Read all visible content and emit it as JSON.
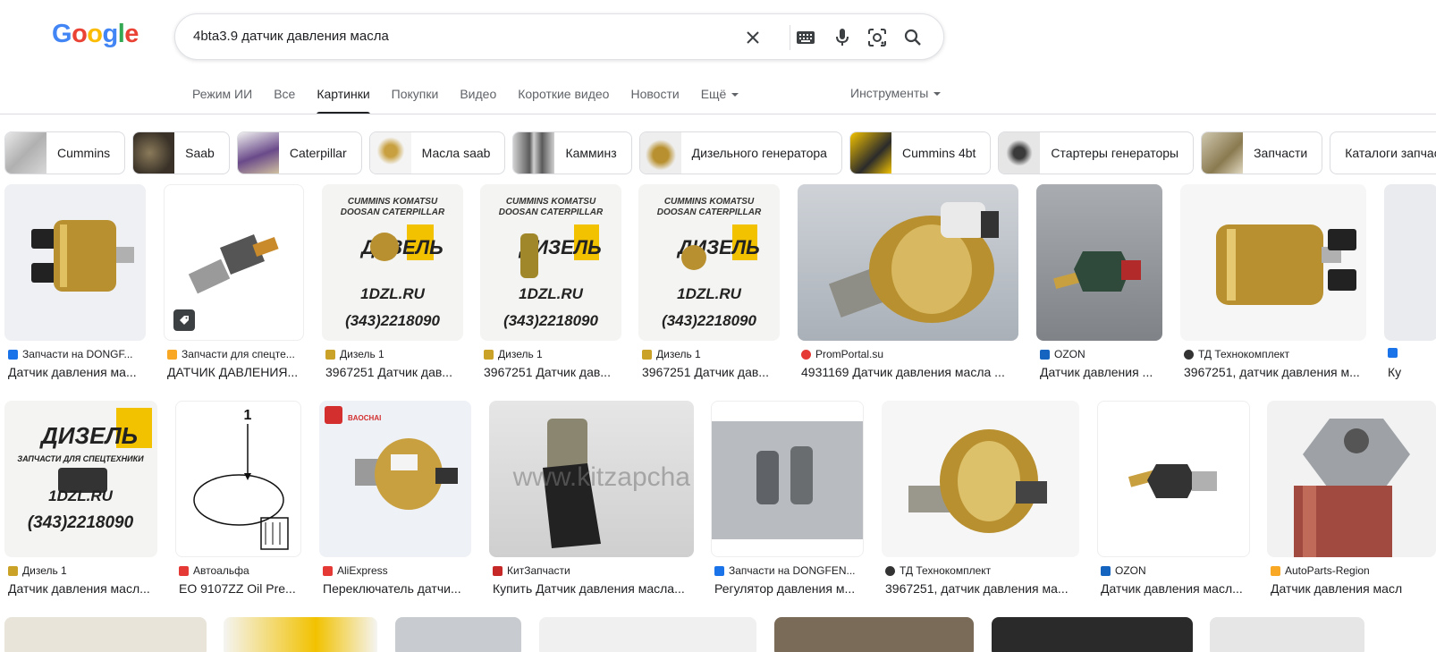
{
  "header": {
    "logo_text": "Google",
    "search_query": "4bta3.9 датчик давления масла"
  },
  "tabs": [
    {
      "label": "Режим ИИ"
    },
    {
      "label": "Все"
    },
    {
      "label": "Картинки",
      "active": true
    },
    {
      "label": "Покупки"
    },
    {
      "label": "Видео"
    },
    {
      "label": "Короткие видео"
    },
    {
      "label": "Новости"
    },
    {
      "label": "Ещё"
    }
  ],
  "tools_label": "Инструменты",
  "chips": [
    {
      "label": "Cummins"
    },
    {
      "label": "Saab"
    },
    {
      "label": "Caterpillar"
    },
    {
      "label": "Масла saab"
    },
    {
      "label": "Камминз"
    },
    {
      "label": "Дизельного генератора"
    },
    {
      "label": "Cummins 4bt"
    },
    {
      "label": "Стартеры генераторы"
    },
    {
      "label": "Запчасти"
    },
    {
      "label": "Каталоги запчастей"
    }
  ],
  "row1": [
    {
      "source": "Запчасти на DONGF...",
      "title": "Датчик давления ма...",
      "fav_color": "#1a73e8"
    },
    {
      "source": "Запчасти для спецте...",
      "title": "ДАТЧИК ДАВЛЕНИЯ...",
      "fav_color": "#f9a825"
    },
    {
      "source": "Дизель 1",
      "title": "3967251 Датчик дав...",
      "fav_color": "#c9a227"
    },
    {
      "source": "Дизель 1",
      "title": "3967251 Датчик дав...",
      "fav_color": "#c9a227"
    },
    {
      "source": "Дизель 1",
      "title": "3967251 Датчик дав...",
      "fav_color": "#c9a227"
    },
    {
      "source": "PromPortal.su",
      "title": "4931169 Датчик давления масла ...",
      "fav_color": "#e53935"
    },
    {
      "source": "OZON",
      "title": "Датчик давления ...",
      "fav_color": "#1565c0"
    },
    {
      "source": "ТД Технокомплект",
      "title": "3967251, датчик давления м...",
      "fav_color": "#333333"
    },
    {
      "source": "",
      "title": "Ку",
      "fav_color": "#1a73e8"
    }
  ],
  "row2": [
    {
      "source": "Дизель 1",
      "title": "Датчик давления масл...",
      "fav_color": "#c9a227"
    },
    {
      "source": "Автоальфа",
      "title": "EO 9107ZZ Oil Pre...",
      "fav_color": "#e53935"
    },
    {
      "source": "AliExpress",
      "title": "Переключатель датчи...",
      "fav_color": "#e53935"
    },
    {
      "source": "КитЗапчасти",
      "title": "Купить Датчик давления масла...",
      "fav_color": "#c62828"
    },
    {
      "source": "Запчасти на DONGFEN...",
      "title": "Регулятор давления м...",
      "fav_color": "#1a73e8"
    },
    {
      "source": "ТД Технокомплект",
      "title": "3967251, датчик давления ма...",
      "fav_color": "#333333"
    },
    {
      "source": "OZON",
      "title": "Датчик давления масл...",
      "fav_color": "#1565c0"
    },
    {
      "source": "AutoParts-Region",
      "title": "Датчик давления масл",
      "fav_color": "#f9a825"
    }
  ],
  "image_text": {
    "diesel_brands_top": "CUMMINS  KOMATSU",
    "diesel_brands_bottom": "DOOSAN CATERPILLAR",
    "diesel_logo": "ДИЗЕЛЬ",
    "diesel_sub": "ЗАПЧАСТИ ДЛЯ СПЕЦТЕХНИКИ",
    "diesel_site": "1DZL.RU",
    "diesel_phone": "(343)2218090",
    "diagram_number": "1",
    "kitzap_wm": "www.kitzapcha",
    "baochai": "BAOCHAI"
  }
}
